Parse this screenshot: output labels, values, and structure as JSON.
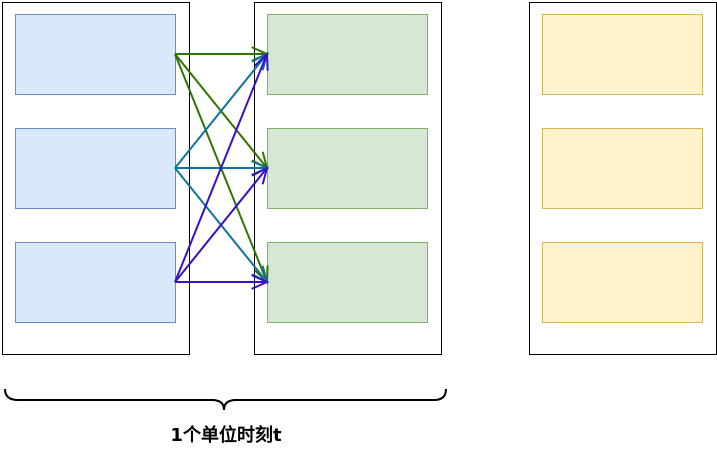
{
  "caption": "1个单位时刻t",
  "colors": {
    "column_border": "#000000",
    "blue_fill": "#dae8fc",
    "blue_stroke": "#6c8ebf",
    "green_fill": "#d5e8d4",
    "green_stroke": "#82b366",
    "yellow_fill": "#fff2cc",
    "yellow_stroke": "#d6b656",
    "arrow_green": "#2d7600",
    "arrow_blue": "#10739e",
    "arrow_purple": "#3a0fcc"
  },
  "columns": [
    {
      "id": "left",
      "node_color": "blue"
    },
    {
      "id": "middle",
      "node_color": "green"
    },
    {
      "id": "right",
      "node_color": "yellow"
    }
  ],
  "connections": [
    {
      "from": 0,
      "to": 0,
      "color": "arrow_green"
    },
    {
      "from": 0,
      "to": 1,
      "color": "arrow_green"
    },
    {
      "from": 0,
      "to": 2,
      "color": "arrow_green"
    },
    {
      "from": 1,
      "to": 0,
      "color": "arrow_blue"
    },
    {
      "from": 1,
      "to": 1,
      "color": "arrow_blue"
    },
    {
      "from": 1,
      "to": 2,
      "color": "arrow_blue"
    },
    {
      "from": 2,
      "to": 0,
      "color": "arrow_purple"
    },
    {
      "from": 2,
      "to": 1,
      "color": "arrow_purple"
    },
    {
      "from": 2,
      "to": 2,
      "color": "arrow_purple"
    }
  ]
}
